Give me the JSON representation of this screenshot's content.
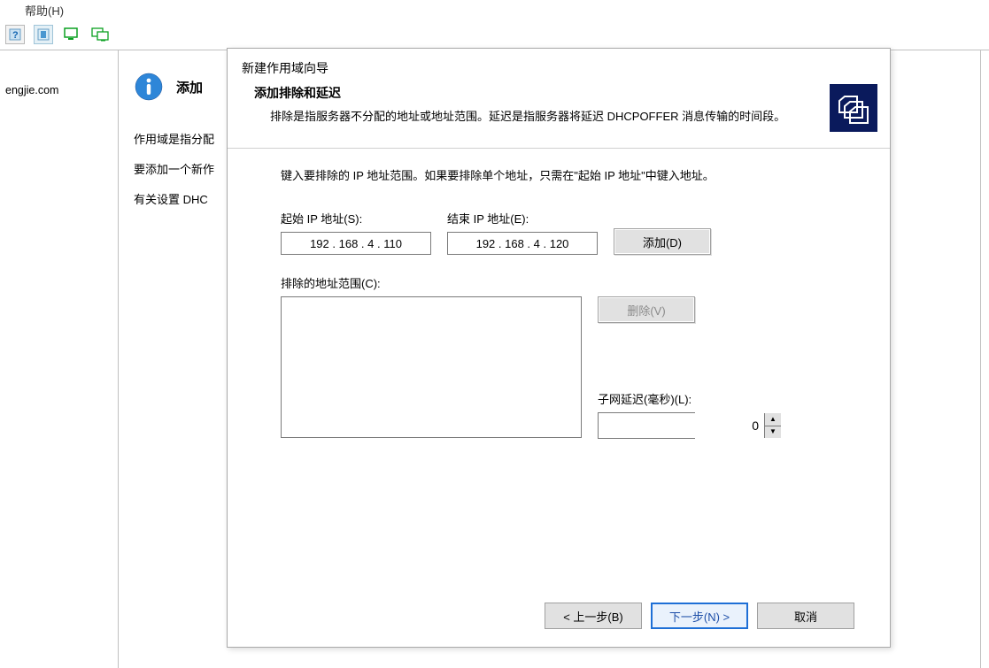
{
  "menubar": {
    "help": "帮助(H)"
  },
  "left_pane": {
    "domain": "engjie.com"
  },
  "content": {
    "add_heading": "添加",
    "scope_desc": "作用域是指分配",
    "add_new_desc": "要添加一个新作",
    "dhcp_setting": "有关设置 DHC"
  },
  "wizard": {
    "title": "新建作用域向导",
    "header_title": "添加排除和延迟",
    "header_desc": "排除是指服务器不分配的地址或地址范围。延迟是指服务器将延迟 DHCPOFFER 消息传输的时间段。",
    "intro": "键入要排除的 IP 地址范围。如果要排除单个地址，只需在\"起始 IP 地址\"中键入地址。",
    "start_ip_label": "起始 IP 地址(S):",
    "end_ip_label": "结束 IP 地址(E):",
    "start_ip_value": "192 . 168 .   4 . 110",
    "end_ip_value": "192 . 168 .   4 . 120",
    "add_btn": "添加(D)",
    "exclusion_label": "排除的地址范围(C):",
    "delete_btn": "删除(V)",
    "delay_label": "子网延迟(毫秒)(L):",
    "delay_value": "0",
    "back_btn": "< 上一步(B)",
    "next_btn": "下一步(N) >",
    "cancel_btn": "取消"
  }
}
